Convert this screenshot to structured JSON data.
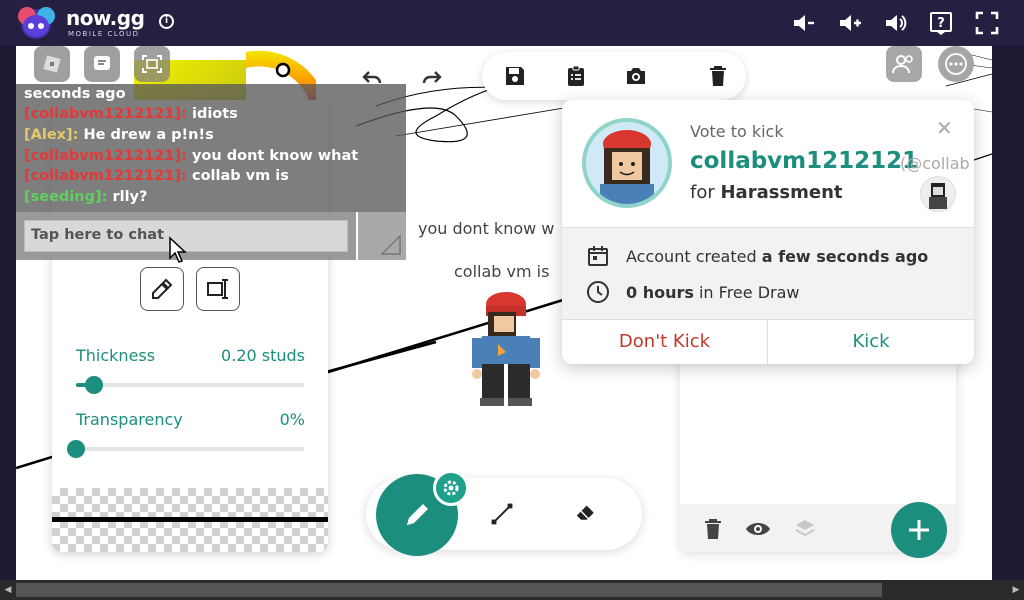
{
  "topbar": {
    "brand": "now.gg",
    "brand_sub": "MOBILE CLOUD",
    "icons": [
      "volume-down-icon",
      "volume-up-icon",
      "volume-icon",
      "help-icon",
      "fullscreen-icon"
    ]
  },
  "toolbar": {
    "icons": [
      "undo-icon",
      "redo-icon",
      "save-icon",
      "clipboard-icon",
      "camera-icon",
      "trash-icon"
    ]
  },
  "chat": {
    "header": "seconds ago",
    "messages": [
      {
        "user": "[collabvm1212121]:",
        "text": "idiots",
        "color": "#e03a3a"
      },
      {
        "user": "[Alex]:",
        "text": "He drew a p!n!s",
        "color": "#e4c86a"
      },
      {
        "user": "[collabvm1212121]:",
        "text": "you dont know what",
        "color": "#e03a3a"
      },
      {
        "user": "[collabvm1212121]:",
        "text": "collab vm is",
        "color": "#e03a3a"
      },
      {
        "user": "[seeding]:",
        "text": "rlly?",
        "color": "#5fd05f"
      }
    ],
    "input_placeholder": "Tap here to chat"
  },
  "canvas": {
    "bubble1": "you dont know w",
    "bubble2": "collab vm is"
  },
  "brush": {
    "thickness_label": "Thickness",
    "thickness_value": "0.20 studs",
    "thickness_fraction": 0.08,
    "transparency_label": "Transparency",
    "transparency_value": "0%",
    "transparency_fraction": 0.0
  },
  "vote": {
    "title": "Vote to kick",
    "username": "collabvm1212121",
    "handle": "(@collab",
    "for_prefix": "for",
    "reason": "Harassment",
    "account_prefix": "Account created",
    "account_value": "a few seconds ago",
    "hours_value": "0 hours",
    "hours_suffix": "in Free Draw",
    "dont_kick": "Don't Kick",
    "kick": "Kick"
  },
  "colors": {
    "accent": "#1c8e7d",
    "topbar": "#251f42",
    "danger": "#c0392b"
  }
}
